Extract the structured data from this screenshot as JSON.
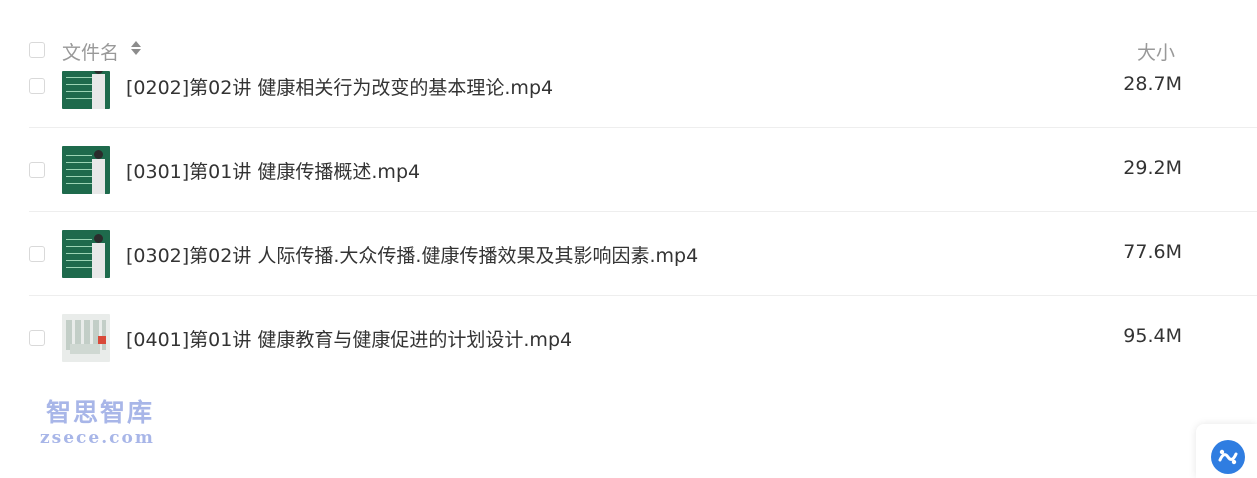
{
  "header": {
    "name_label": "文件名",
    "size_label": "大小"
  },
  "files": [
    {
      "name": "[0202]第02讲 健康相关行为改变的基本理论.mp4",
      "size": "28.7M",
      "thumbnail": "video-thumbnail"
    },
    {
      "name": "[0301]第01讲 健康传播概述.mp4",
      "size": "29.2M",
      "thumbnail": "video-thumbnail"
    },
    {
      "name": "[0302]第02讲 人际传播.大众传播.健康传播效果及其影响因素.mp4",
      "size": "77.6M",
      "thumbnail": "video-thumbnail"
    },
    {
      "name": "[0401]第01讲 健康教育与健康促进的计划设计.mp4",
      "size": "95.4M",
      "thumbnail": "video-thumbnail"
    }
  ],
  "watermark": {
    "chinese": "智思智库",
    "domain": "zsece.com"
  },
  "colors": {
    "text": "#333333",
    "header_text": "#999999",
    "divider": "#eeeeee",
    "accent": "#2f7de1",
    "watermark": "#a8b6e8"
  },
  "icons": {
    "sort": "sort-icon",
    "float_button": "assistant-icon"
  }
}
